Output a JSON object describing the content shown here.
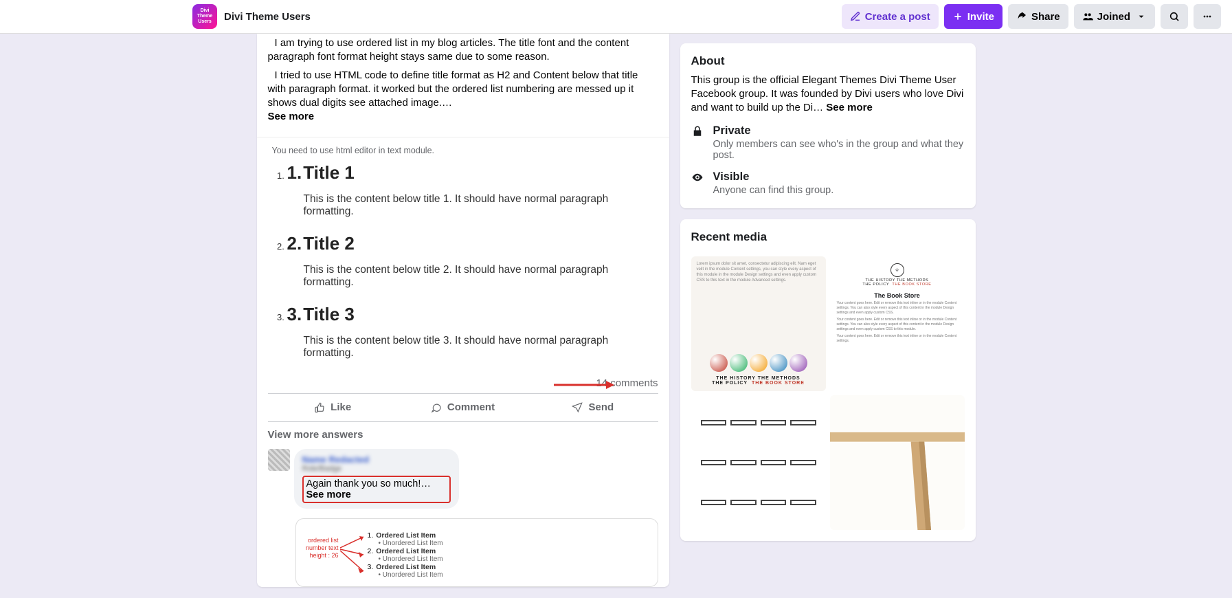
{
  "group": {
    "name": "Divi Theme Users",
    "avatar_text": "Divi Theme Users"
  },
  "topbar": {
    "create_post": "Create a post",
    "invite": "Invite",
    "share": "Share",
    "joined": "Joined"
  },
  "post": {
    "greeting_cut": "",
    "p1": "I am trying to use ordered list in my blog articles. The title font and the content paragraph font format height stays same due to some reason.",
    "p2": "I tried to use HTML code to define title format as H2 and Content below that title with paragraph format. it worked but the ordered list numbering are messed up it shows dual digits see attached image.…",
    "see_more": "See more",
    "attach_note": "You need to use html editor in text module.",
    "items": [
      {
        "num": "1.",
        "title": "Title 1",
        "content": "This is the content below title 1. It should have normal paragraph formatting."
      },
      {
        "num": "2.",
        "title": "Title 2",
        "content": "This is the content below title 2. It should have normal paragraph formatting."
      },
      {
        "num": "3.",
        "title": "Title 3",
        "content": "This is the content below title 3. It should have normal paragraph formatting."
      }
    ],
    "comment_count": "14 comments",
    "actions": {
      "like": "Like",
      "comment": "Comment",
      "send": "Send"
    },
    "view_more": "View more answers",
    "reply": {
      "name_blur": "Name Redacted",
      "sub_blur": "Role/Badge",
      "text": "Again thank you so much!…",
      "see_more": "See more",
      "diagram": {
        "left_label": "ordered list\nnumber text\nheight : 26",
        "rows": [
          {
            "n": "1.",
            "t": "Ordered List Item",
            "sub": "Unordered List Item"
          },
          {
            "n": "2.",
            "t": "Ordered List Item",
            "sub": "Unordered List Item"
          },
          {
            "n": "3.",
            "t": "Ordered List Item",
            "sub": "Unordered List Item"
          }
        ]
      }
    }
  },
  "about": {
    "heading": "About",
    "desc_prefix": "This group is the official Elegant Themes Divi Theme User Facebook group. It was founded by Divi users who love Divi and want to build up the Di…",
    "see_more": "See more",
    "private": {
      "title": "Private",
      "text": "Only members can see who's in the group and what they post."
    },
    "visible": {
      "title": "Visible",
      "text": "Anyone can find this group."
    }
  },
  "media": {
    "heading": "Recent media",
    "tile1_caption_a": "THE HISTORY   THE METHODS",
    "tile1_caption_b": "THE POLICY",
    "tile1_caption_c": "THE BOOK STORE",
    "tile2_top_a": "THE HISTORY   THE METHODS",
    "tile2_top_b": "THE POLICY",
    "tile2_top_c": "THE BOOK STORE",
    "tile2_h": "The Book Store"
  }
}
